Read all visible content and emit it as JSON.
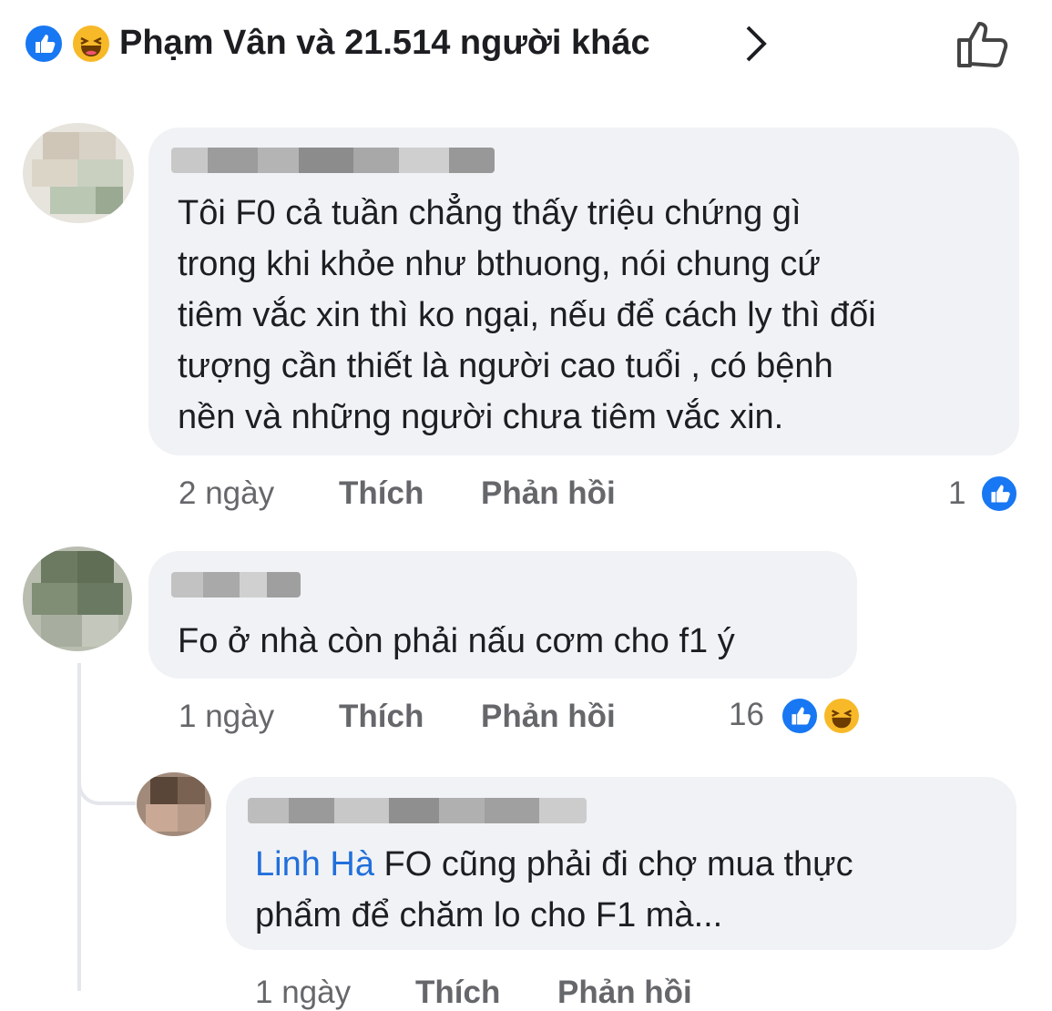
{
  "reactions": {
    "summary": "Phạm Vân và 21.514 người khác",
    "icons": [
      "like-icon",
      "haha-icon"
    ]
  },
  "comments": [
    {
      "text_lines": [
        "Tôi F0 cả tuần chẳng thấy triệu chứng gì",
        "trong khi khỏe như bthuong, nói chung cứ",
        "tiêm vắc xin thì ko ngại, nếu để cách ly thì đối",
        "tượng cần thiết là người cao tuổi , có bệnh",
        "nền và những người chưa tiêm vắc xin."
      ],
      "time": "2 ngày",
      "like_label": "Thích",
      "reply_label": "Phản hồi",
      "reaction_count": "1"
    },
    {
      "text_lines": [
        "Fo ở nhà còn phải nấu cơm cho f1 ý"
      ],
      "time": "1 ngày",
      "like_label": "Thích",
      "reply_label": "Phản hồi",
      "reaction_count": "16"
    },
    {
      "mention": "Linh Hà",
      "text_line1": " FO cũng phải đi chợ mua thực",
      "text_line2": "phẩm để chăm lo cho F1 mà...",
      "time": "1 ngày",
      "like_label": "Thích",
      "reply_label": "Phản hồi"
    }
  ],
  "colors": {
    "bubble": "#f0f2f5",
    "like_blue": "#1877f2",
    "haha_yellow": "#f7b928",
    "meta_gray": "#65676b",
    "mention_blue": "#216fdb"
  }
}
